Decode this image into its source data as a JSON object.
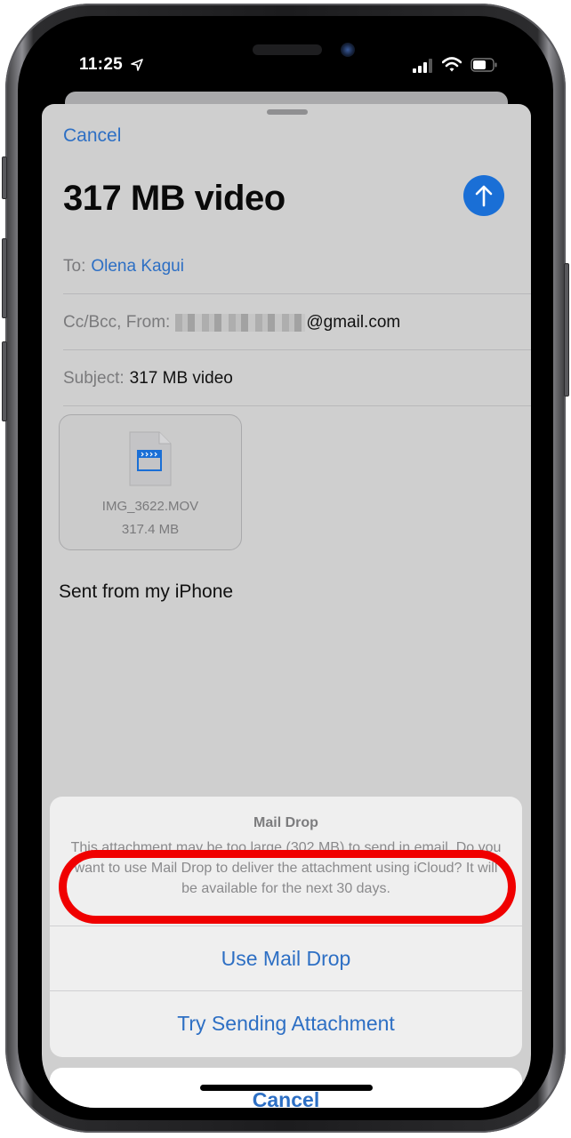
{
  "status_bar": {
    "time": "11:25",
    "icons": [
      "location-arrow-icon",
      "cellular-signal-icon",
      "wifi-icon",
      "battery-icon"
    ]
  },
  "compose": {
    "cancel_label": "Cancel",
    "title": "317 MB video",
    "send_icon": "arrow-up-icon",
    "to_label": "To:",
    "to_value": "Olena Kagui",
    "cc_label": "Cc/Bcc, From:",
    "from_domain": "@gmail.com",
    "subject_label": "Subject:",
    "subject_value": "317 MB video",
    "attachment": {
      "icon": "video-file-icon",
      "name": "IMG_3622.MOV",
      "size": "317.4 MB"
    },
    "body": "Sent from my iPhone"
  },
  "action_sheet": {
    "title": "Mail Drop",
    "message": "This attachment may be too large (302 MB) to send in email. Do you want to use Mail Drop to deliver the attachment using iCloud? It will be available for the next 30 days.",
    "options": [
      {
        "label": "Use Mail Drop",
        "highlighted": true
      },
      {
        "label": "Try Sending Attachment",
        "highlighted": false
      }
    ],
    "cancel_label": "Cancel"
  },
  "colors": {
    "accent": "#2d6fc4",
    "send_button": "#1a6fd6",
    "highlight_ring": "#f00000",
    "sheet_background": "#cfcfcf"
  }
}
